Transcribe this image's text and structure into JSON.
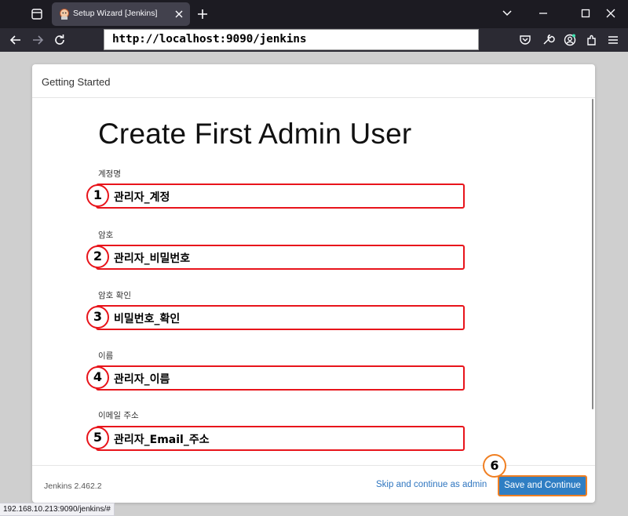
{
  "browser": {
    "tab_title": "Setup Wizard [Jenkins]",
    "url": "http://localhost:9090/jenkins",
    "status_url": "192.168.10.213:9090/jenkins/#"
  },
  "dialog": {
    "header_title": "Getting Started",
    "heading": "Create First Admin User",
    "fields": [
      {
        "label": "계정명",
        "value": "관리자_계정",
        "badge": "1"
      },
      {
        "label": "암호",
        "value": "관리자_비밀번호",
        "badge": "2"
      },
      {
        "label": "암호 확인",
        "value": "비밀번호_확인",
        "badge": "3"
      },
      {
        "label": "이름",
        "value": "관리자_이름",
        "badge": "4"
      },
      {
        "label": "이메일 주소",
        "value": "관리자_Email_주소",
        "badge": "5"
      }
    ],
    "footer": {
      "version": "Jenkins 2.462.2",
      "skip_label": "Skip and continue as admin",
      "save_label": "Save and Continue",
      "save_badge": "6"
    }
  },
  "colors": {
    "highlight_red": "#e8141b",
    "highlight_orange": "#f07f22",
    "primary_button": "#2f7ec3",
    "link": "#2f76c0"
  },
  "icons": [
    "tab-list-icon",
    "jenkins-favicon",
    "close-icon",
    "plus-icon",
    "chevron-down-icon",
    "minimize-icon",
    "maximize-icon",
    "window-close-icon",
    "back-arrow-icon",
    "forward-arrow-icon",
    "reload-icon",
    "pocket-icon",
    "wrench-icon",
    "account-icon",
    "extensions-icon",
    "menu-icon"
  ]
}
